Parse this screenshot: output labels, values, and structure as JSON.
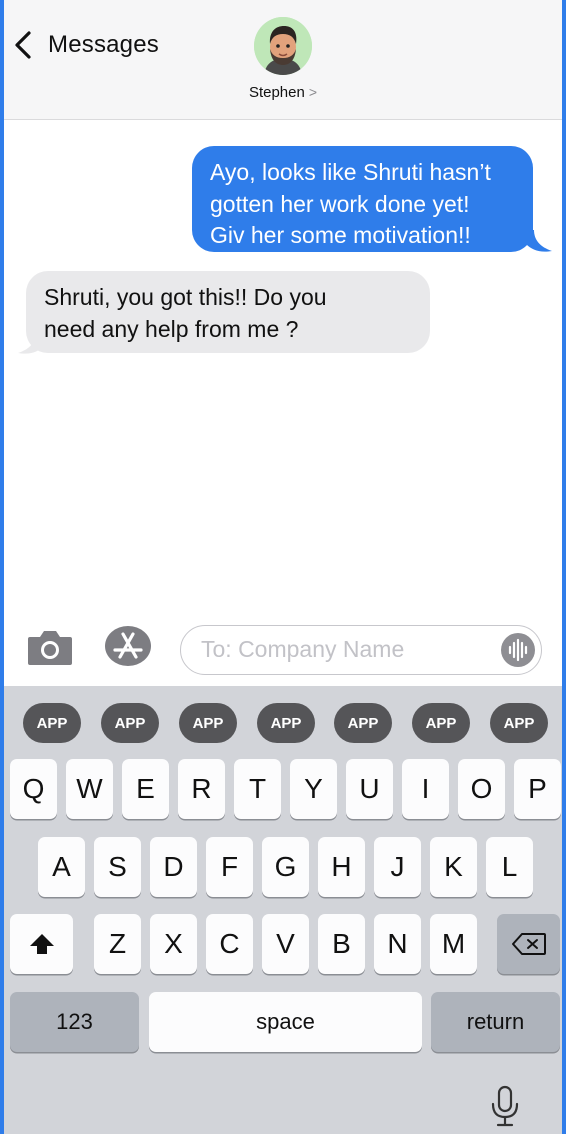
{
  "header": {
    "back_label": "Messages",
    "contact_name": "Stephen",
    "chevron": ">"
  },
  "messages": [
    {
      "direction": "sent",
      "lines": [
        "Ayo, looks like Shruti hasn’t",
        "gotten her work done yet!",
        "Giv her some motivation!!"
      ]
    },
    {
      "direction": "received",
      "lines": [
        "Shruti, you got this!! Do you",
        "need any help from me ?"
      ]
    }
  ],
  "compose": {
    "placeholder": "To: Company Name",
    "value": ""
  },
  "keyboard": {
    "app_pills": [
      "APP",
      "APP",
      "APP",
      "APP",
      "APP",
      "APP",
      "APP"
    ],
    "row1": [
      "Q",
      "W",
      "E",
      "R",
      "T",
      "Y",
      "U",
      "I",
      "O",
      "P"
    ],
    "row2": [
      "A",
      "S",
      "D",
      "F",
      "G",
      "H",
      "J",
      "K",
      "L"
    ],
    "row3": [
      "Z",
      "X",
      "C",
      "V",
      "B",
      "N",
      "M"
    ],
    "numbers_label": "123",
    "space_label": "space",
    "return_label": "return"
  },
  "colors": {
    "sent_bubble": "#2f7dea",
    "received_bubble": "#e9e9eb",
    "keyboard_bg": "#d2d4d9",
    "avatar_bg": "#bfe7b8"
  },
  "icons": [
    "chevron-left-icon",
    "camera-icon",
    "app-store-icon",
    "waveform-icon",
    "shift-icon",
    "delete-icon",
    "microphone-icon"
  ]
}
